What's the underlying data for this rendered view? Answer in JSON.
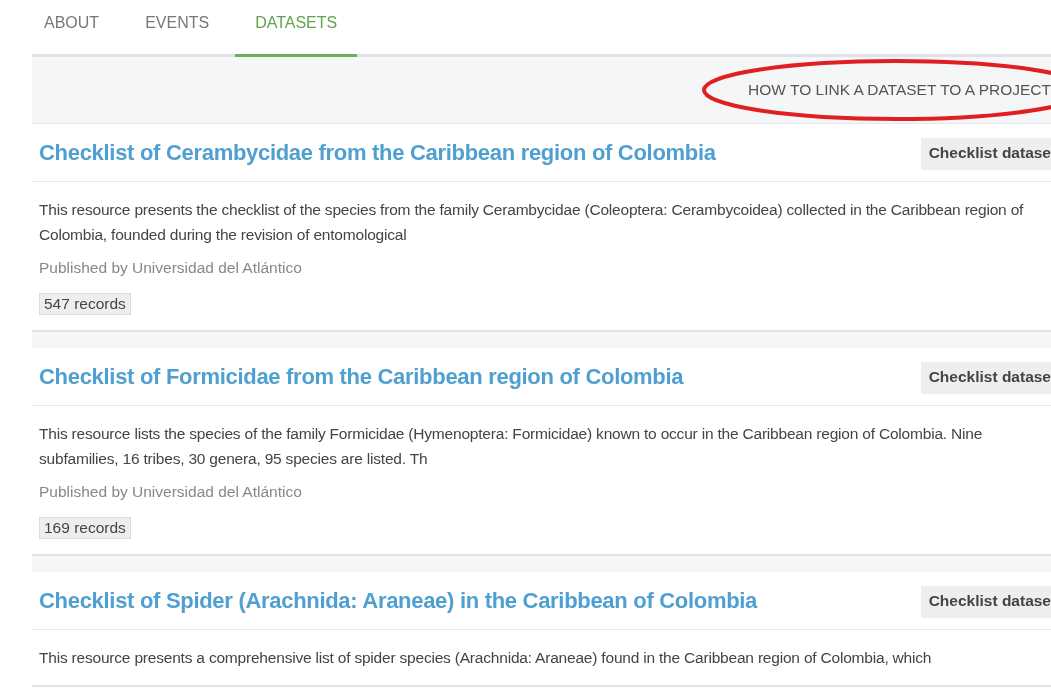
{
  "tabs": [
    {
      "label": "ABOUT",
      "selected": false
    },
    {
      "label": "EVENTS",
      "selected": false
    },
    {
      "label": "DATASETS",
      "selected": true
    }
  ],
  "toolbar": {
    "help_link": "HOW TO LINK A DATASET TO A PROJECT"
  },
  "datasets": [
    {
      "title": "Checklist of Cerambycidae from the Caribbean region of Colombia",
      "type": "Checklist datase",
      "description": "This resource presents the checklist of the species from the family Cerambycidae (Coleoptera: Cerambycoidea) collected in the Caribbean region of Colombia, founded during the revision of entomological",
      "publisher": "Published by Universidad del Atlántico",
      "records": "547 records"
    },
    {
      "title": "Checklist of Formicidae from the Caribbean region of Colombia",
      "type": "Checklist datase",
      "description": "This resource lists the species of the family Formicidae (Hymenoptera: Formicidae) known to occur in the Caribbean region of Colombia. Nine subfamilies, 16 tribes, 30 genera, 95 species are listed. Th",
      "publisher": "Published by Universidad del Atlántico",
      "records": "169 records"
    },
    {
      "title": "Checklist of Spider (Arachnida: Araneae) in the Caribbean of Colombia",
      "type": "Checklist datase",
      "description": "This resource presents a comprehensive list of spider species (Arachnida: Araneae) found in the Caribbean region of Colombia, which"
    }
  ]
}
